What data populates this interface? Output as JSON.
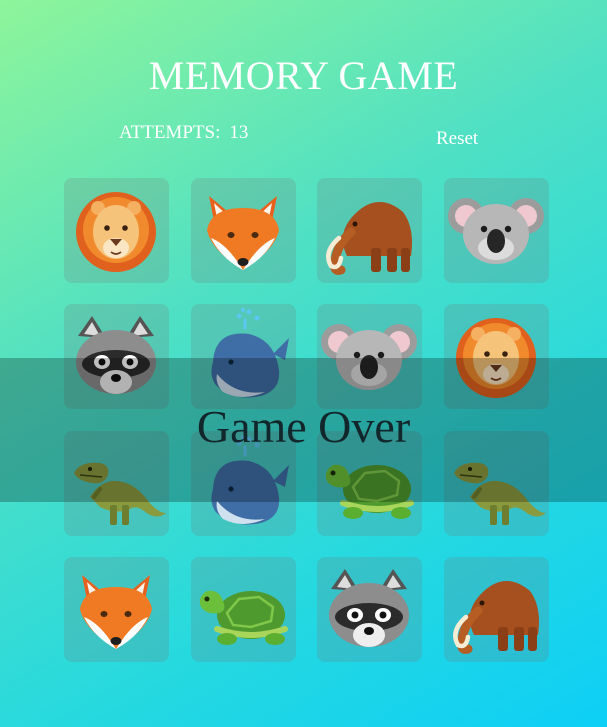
{
  "header": {
    "title": "MEMORY GAME"
  },
  "stats": {
    "attempts_label": "ATTEMPTS:",
    "attempts_value": "13"
  },
  "controls": {
    "reset_label": "Reset"
  },
  "board": {
    "cards": [
      {
        "animal": "lion"
      },
      {
        "animal": "fox"
      },
      {
        "animal": "mammoth"
      },
      {
        "animal": "koala"
      },
      {
        "animal": "raccoon"
      },
      {
        "animal": "whale"
      },
      {
        "animal": "koala"
      },
      {
        "animal": "lion"
      },
      {
        "animal": "t-rex"
      },
      {
        "animal": "whale"
      },
      {
        "animal": "turtle"
      },
      {
        "animal": "t-rex"
      },
      {
        "animal": "fox"
      },
      {
        "animal": "turtle"
      },
      {
        "animal": "raccoon"
      },
      {
        "animal": "mammoth"
      }
    ]
  },
  "overlay": {
    "message": "Game Over"
  }
}
